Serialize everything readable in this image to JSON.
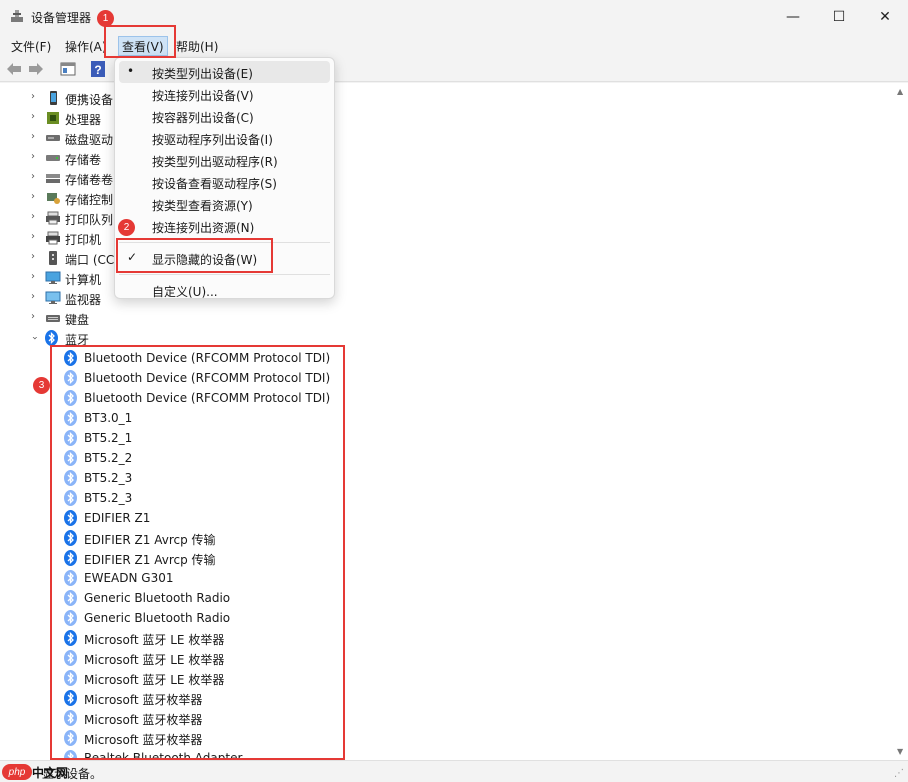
{
  "window": {
    "title": "设备管理器",
    "minimize": "—",
    "maximize": "☐",
    "close": "✕"
  },
  "menubar": {
    "file": "文件(F)",
    "action": "操作(A)",
    "view": "查看(V)",
    "help": "帮助(H)"
  },
  "view_menu": {
    "items": [
      {
        "label": "按类型列出设备(E)",
        "mark": "•"
      },
      {
        "label": "按连接列出设备(V)",
        "mark": ""
      },
      {
        "label": "按容器列出设备(C)",
        "mark": ""
      },
      {
        "label": "按驱动程序列出设备(I)",
        "mark": ""
      },
      {
        "label": "按类型列出驱动程序(R)",
        "mark": ""
      },
      {
        "label": "按设备查看驱动程序(S)",
        "mark": ""
      },
      {
        "label": "按类型查看资源(Y)",
        "mark": ""
      },
      {
        "label": "按连接列出资源(N)",
        "mark": ""
      }
    ],
    "show_hidden": {
      "label": "显示隐藏的设备(W)",
      "mark": "✓"
    },
    "customize": {
      "label": "自定义(U)..."
    }
  },
  "tree": {
    "categories": [
      {
        "label": "便携设备",
        "icon": "portable-device-icon"
      },
      {
        "label": "处理器",
        "icon": "processor-icon"
      },
      {
        "label": "磁盘驱动",
        "icon": "disk-drive-icon"
      },
      {
        "label": "存储卷",
        "icon": "storage-volume-icon"
      },
      {
        "label": "存储卷卷",
        "icon": "storage-volume-shadow-icon"
      },
      {
        "label": "存储控制",
        "icon": "storage-controller-icon"
      },
      {
        "label": "打印队列",
        "icon": "print-queue-icon"
      },
      {
        "label": "打印机",
        "icon": "printer-icon"
      },
      {
        "label": "端口 (CC",
        "icon": "port-icon"
      },
      {
        "label": "计算机",
        "icon": "computer-icon"
      },
      {
        "label": "监视器",
        "icon": "monitor-icon"
      },
      {
        "label": "键盘",
        "icon": "keyboard-icon"
      }
    ],
    "bluetooth": {
      "label": "蓝牙",
      "expanded": true,
      "devices": [
        {
          "label": "Bluetooth Device (RFCOMM Protocol TDI)",
          "hidden": false
        },
        {
          "label": "Bluetooth Device (RFCOMM Protocol TDI)",
          "hidden": true
        },
        {
          "label": "Bluetooth Device (RFCOMM Protocol TDI)",
          "hidden": true
        },
        {
          "label": "BT3.0_1",
          "hidden": true
        },
        {
          "label": "BT5.2_1",
          "hidden": true
        },
        {
          "label": "BT5.2_2",
          "hidden": true
        },
        {
          "label": "BT5.2_3",
          "hidden": true
        },
        {
          "label": "BT5.2_3",
          "hidden": true
        },
        {
          "label": "EDIFIER Z1",
          "hidden": false
        },
        {
          "label": "EDIFIER Z1 Avrcp 传输",
          "hidden": false
        },
        {
          "label": "EDIFIER Z1 Avrcp 传输",
          "hidden": false
        },
        {
          "label": "EWEADN G301",
          "hidden": true
        },
        {
          "label": "Generic Bluetooth Radio",
          "hidden": true
        },
        {
          "label": "Generic Bluetooth Radio",
          "hidden": true
        },
        {
          "label": "Microsoft 蓝牙 LE 枚举器",
          "hidden": false
        },
        {
          "label": "Microsoft 蓝牙 LE 枚举器",
          "hidden": true
        },
        {
          "label": "Microsoft 蓝牙 LE 枚举器",
          "hidden": true
        },
        {
          "label": "Microsoft 蓝牙枚举器",
          "hidden": false
        },
        {
          "label": "Microsoft 蓝牙枚举器",
          "hidden": true
        },
        {
          "label": "Microsoft 蓝牙枚举器",
          "hidden": true
        },
        {
          "label": "Realtek Bluetooth Adapter",
          "hidden": true
        }
      ]
    }
  },
  "annotations": {
    "badge1": "1",
    "badge2": "2",
    "badge3": "3"
  },
  "status": {
    "text": "显示设备。",
    "watermark_logo": "php",
    "watermark_text": "中文网"
  },
  "colors": {
    "accent_red": "#e53935",
    "bt_blue": "#1a73e8",
    "bt_hidden": "#8ab4f8"
  }
}
